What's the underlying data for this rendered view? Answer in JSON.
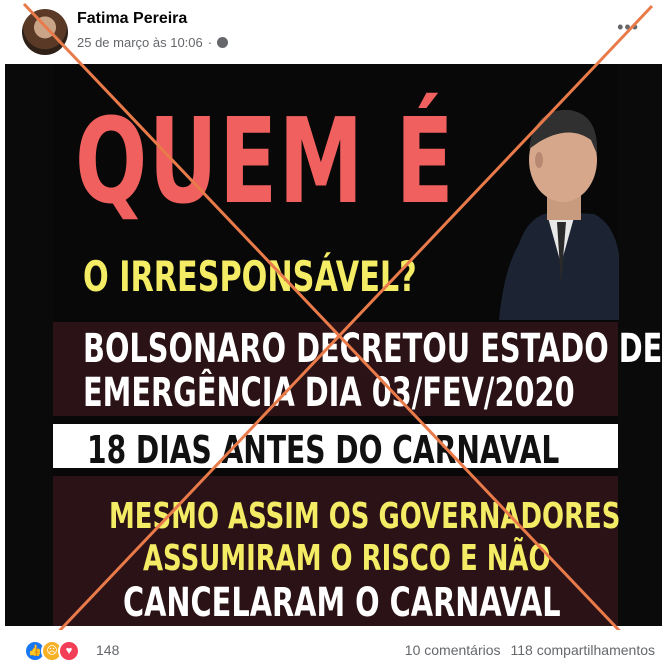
{
  "post": {
    "author": "Fatima Pereira",
    "timestamp": "25 de março às 10:06",
    "privacy_icon": "globe-icon",
    "more_icon": "more-options-icon"
  },
  "image": {
    "headline": "QUEM É",
    "question": "O IRRESPONSÁVEL?",
    "line1": "BOLSONARO DECRETOU ESTADO DE",
    "line2": "EMERGÊNCIA DIA 03/FEV/2020",
    "line3": "18 DIAS ANTES DO CARNAVAL",
    "line4": "MESMO ASSIM OS GOVERNADORES",
    "line5": "ASSUMIRAM O RISCO E NÃO",
    "line6": "CANCELARAM O CARNAVAL",
    "colors": {
      "headline": "#f0605e",
      "yellow": "#f4ec64",
      "band": "#2a1216",
      "cross": "#e97a4a"
    }
  },
  "footer": {
    "reactions": [
      "like-icon",
      "sad-icon",
      "love-icon"
    ],
    "reaction_count": "148",
    "comments": "10 comentários",
    "shares": "118 compartilhamentos"
  }
}
